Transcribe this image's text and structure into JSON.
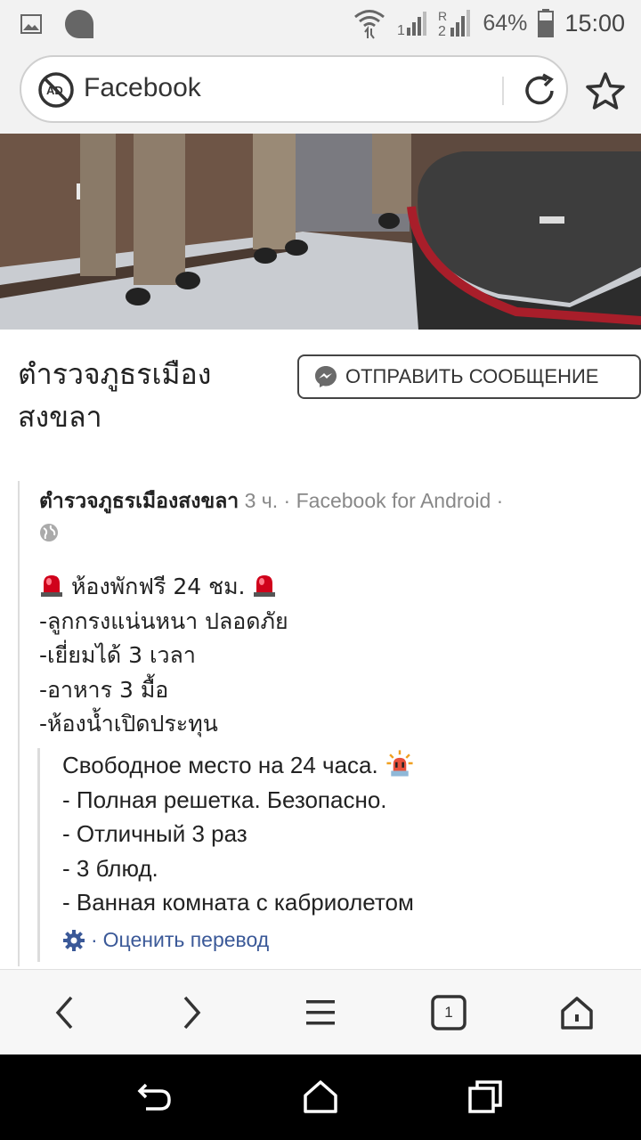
{
  "status_bar": {
    "battery": "64%",
    "time": "15:00",
    "icons": [
      "image-icon",
      "chat-bubble-icon",
      "wifi-icon",
      "signal-icon",
      "signal-roaming-icon",
      "battery-icon"
    ]
  },
  "url_bar": {
    "address": "Facebook",
    "icons": [
      "adblock-icon",
      "reload-icon",
      "star-icon"
    ]
  },
  "page": {
    "name_line1": "ตำรวจภูธรเมือง",
    "name_line2": "สงขลา",
    "send_message_label": "ОТПРАВИТЬ СООБЩЕНИЕ"
  },
  "post": {
    "author": "ตำรวจภูธรเมืองสงขลา",
    "meta": " 3 ч. · Facebook for Android ·",
    "lines": [
      "ห้องพักฟรี 24 ชม.",
      "-ลูกกรงแน่นหนา ปลอดภัย",
      "-เยี่ยมได้ 3 เวลา",
      "-อาหาร 3 มื้อ",
      "-ห้องน้ำเปิดประทุน"
    ]
  },
  "translation": {
    "lines": [
      "Свободное место на 24 часа.",
      "- Полная решетка. Безопасно.",
      "- Отличный 3 раз",
      "- 3 блюд.",
      "- Ванная комната с кабриолетом"
    ],
    "separator": "·",
    "rate_label": "Оценить перевод"
  },
  "toolbar": {
    "tab_count": "1",
    "icons": [
      "back-icon",
      "forward-icon",
      "menu-icon",
      "tabs-icon",
      "home-icon"
    ]
  },
  "colors": {
    "link": "#3b5998",
    "siren_red": "#d0021b",
    "nav_bg": "#000000"
  }
}
